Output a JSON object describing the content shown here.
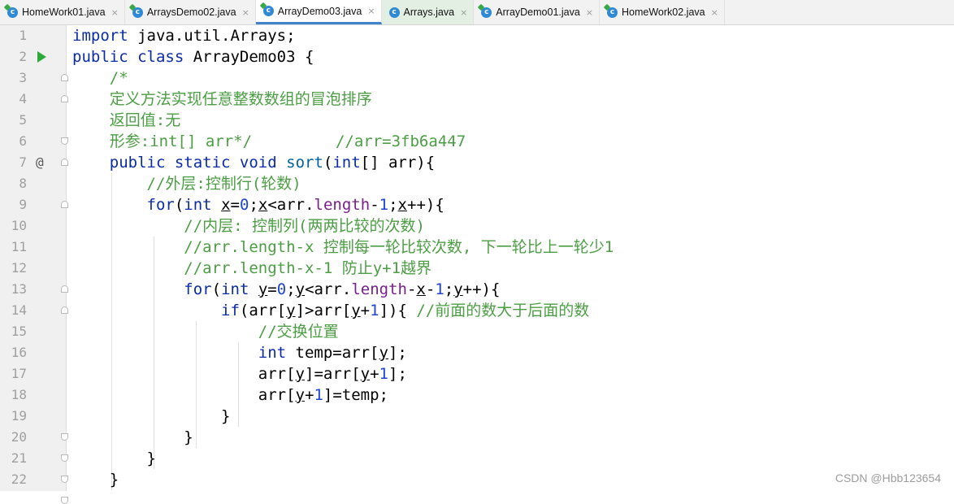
{
  "tabs": [
    {
      "label": "HomeWork01.java",
      "active": false,
      "icon": "java-class-icon"
    },
    {
      "label": "ArraysDemo02.java",
      "active": false,
      "icon": "java-class-icon"
    },
    {
      "label": "ArrayDemo03.java",
      "active": true,
      "icon": "java-class-icon"
    },
    {
      "label": "Arrays.java",
      "active": false,
      "icon": "library-class-icon"
    },
    {
      "label": "ArrayDemo01.java",
      "active": false,
      "icon": "java-class-icon"
    },
    {
      "label": "HomeWork02.java",
      "active": false,
      "icon": "java-class-icon"
    }
  ],
  "tab_close_glyph": "×",
  "gutter": {
    "line_numbers": [
      "1",
      "2",
      "3",
      "4",
      "5",
      "6",
      "7",
      "8",
      "9",
      "10",
      "11",
      "12",
      "13",
      "14",
      "15",
      "16",
      "17",
      "18",
      "19",
      "20",
      "21",
      "22"
    ],
    "override_marker": "@"
  },
  "code": {
    "l1": [
      "import",
      " java.util.Arrays;"
    ],
    "l2": [
      "public class",
      " ArrayDemo03 {"
    ],
    "l3": [
      "    /*"
    ],
    "l4": [
      "    定义方法实现任意整数数组的冒泡排序"
    ],
    "l5": [
      "    返回值:无"
    ],
    "l6": [
      "    形参:int[] arr*/",
      "         //arr=3fb6a447"
    ],
    "l7": [
      "    ",
      "public static void",
      " ",
      "sort",
      "(",
      "int",
      "[] arr){"
    ],
    "l8": [
      "        //外层:控制行(轮数)"
    ],
    "l9": [
      "        ",
      "for",
      "(",
      "int",
      " ",
      "x",
      "=",
      "0",
      ";",
      "x",
      "<arr.",
      "length",
      "-",
      "1",
      ";",
      "x",
      "++){"
    ],
    "l10": [
      "            //内层: 控制列(两两比较的次数)"
    ],
    "l11": [
      "            //arr.length-x 控制每一轮比较次数, 下一轮比上一轮少1"
    ],
    "l12": [
      "            //arr.length-x-1 防止y+1越界"
    ],
    "l13": [
      "            ",
      "for",
      "(",
      "int",
      " ",
      "y",
      "=",
      "0",
      ";",
      "y",
      "<arr.",
      "length",
      "-",
      "x",
      "-",
      "1",
      ";",
      "y",
      "++){"
    ],
    "l14": [
      "                ",
      "if",
      "(arr[",
      "y",
      "]>arr[",
      "y",
      "+",
      "1",
      "]){ ",
      "//前面的数大于后面的数"
    ],
    "l15": [
      "                    //交换位置"
    ],
    "l16": [
      "                    ",
      "int",
      " temp=arr[",
      "y",
      "];"
    ],
    "l17": [
      "                    arr[",
      "y",
      "]=arr[",
      "y",
      "+",
      "1",
      "];"
    ],
    "l18": [
      "                    arr[",
      "y",
      "+",
      "1",
      "]=temp;"
    ],
    "l19": [
      "                }"
    ],
    "l20": [
      "            }"
    ],
    "l21": [
      "        }"
    ],
    "l22": [
      "    }"
    ]
  },
  "watermark": "CSDN @Hbb123654",
  "colors": {
    "keyword": "#0b2ba8",
    "comment": "#4b9e43",
    "number": "#1d44d9",
    "method": "#00629c",
    "field": "#7a1d8f",
    "active_tab_underline": "#4083c9",
    "run_icon": "#2eaa3c"
  }
}
